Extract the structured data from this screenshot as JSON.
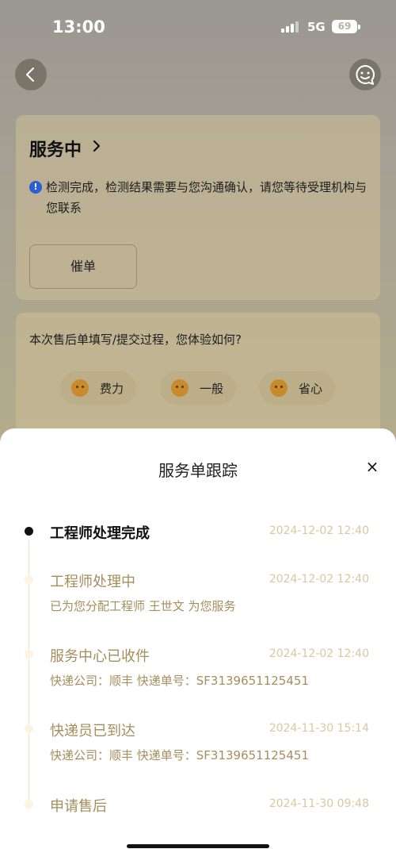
{
  "status_bar": {
    "time": "13:00",
    "network": "5G",
    "battery": "69"
  },
  "header": {
    "back_icon": "chevron-left-icon",
    "service_icon": "chat-bubble-icon"
  },
  "status_card": {
    "title": "服务中",
    "info": "检测完成，检测结果需要与您沟通确认，请您等待受理机构与您联系",
    "urge_button": "催单"
  },
  "survey": {
    "question": "本次售后单填写/提交过程，您体验如何?",
    "options": [
      {
        "label": "费力",
        "icon": "struggling-face-icon"
      },
      {
        "label": "一般",
        "icon": "neutral-face-icon"
      },
      {
        "label": "省心",
        "icon": "relieved-face-icon"
      }
    ]
  },
  "tracking": {
    "title": "服务单跟踪",
    "close_label": "×",
    "steps": [
      {
        "title": "工程师处理完成",
        "time": "2024-12-02 12:40",
        "desc": "",
        "active": true
      },
      {
        "title": "工程师处理中",
        "time": "2024-12-02 12:40",
        "desc": "已为您分配工程师 王世文 为您服务",
        "active": false
      },
      {
        "title": "服务中心已收件",
        "time": "2024-12-02 12:40",
        "desc": "快递公司：顺丰 快递单号：SF3139651125451",
        "active": false
      },
      {
        "title": "快递员已到达",
        "time": "2024-11-30 15:14",
        "desc": "快递公司：顺丰 快递单号：SF3139651125451",
        "active": false
      },
      {
        "title": "申请售后",
        "time": "2024-11-30 09:48",
        "desc": "",
        "active": false
      }
    ]
  }
}
